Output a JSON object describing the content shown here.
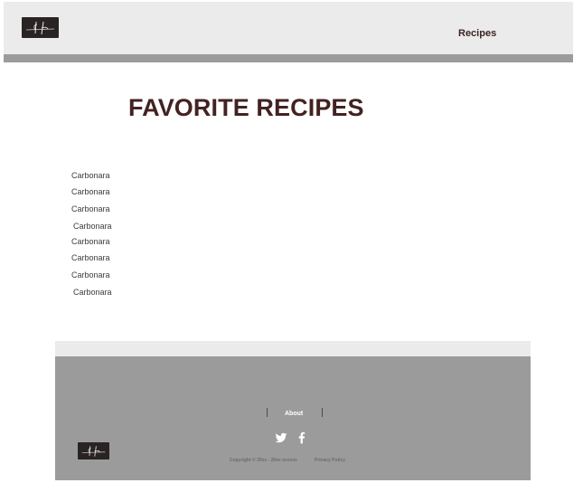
{
  "header": {
    "logo": "lf-signature-logo",
    "nav_recipes": "Recipes"
  },
  "main": {
    "title": "FAVORITE RECIPES",
    "recipes": [
      {
        "label": "Carbonara"
      },
      {
        "label": "Carbonara"
      },
      {
        "label": "Carbonara"
      },
      {
        "label": "Carbonara"
      },
      {
        "label": "Carbonara"
      },
      {
        "label": "Carbonara"
      },
      {
        "label": "Carbonara"
      },
      {
        "label": "Carbonara"
      }
    ]
  },
  "footer": {
    "about": "About",
    "social": [
      "twitter-icon",
      "facebook-icon"
    ],
    "copyright": "Copyright © 20xx - 20xx xxxxxx",
    "privacy": "Privacy Policy",
    "logo": "lf-signature-logo"
  },
  "colors": {
    "header_bg": "#ebebeb",
    "header_bar": "#9b9b9b",
    "title": "#432222",
    "footer_bg": "#9b9b9b",
    "logo_bg": "#2a2323"
  }
}
